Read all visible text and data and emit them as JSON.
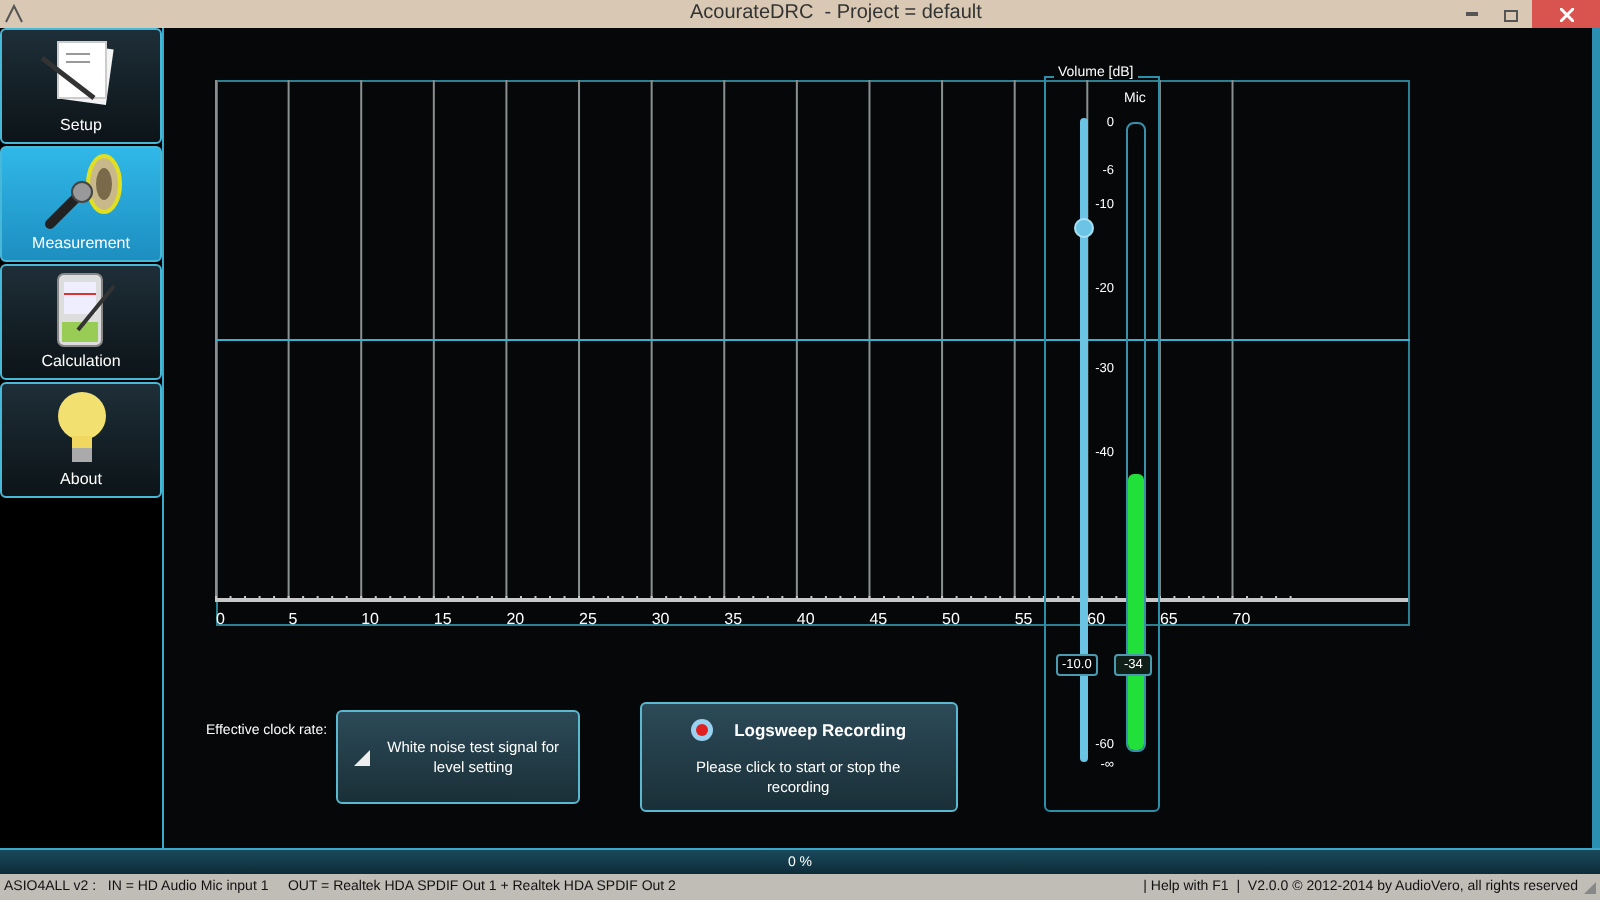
{
  "window": {
    "title": "AcourateDRC  - Project = default"
  },
  "sidebar": {
    "items": [
      {
        "label": "Setup",
        "selected": false,
        "kind": "setup"
      },
      {
        "label": "Measurement",
        "selected": true,
        "kind": "measure"
      },
      {
        "label": "Calculation",
        "selected": false,
        "kind": "calc"
      },
      {
        "label": "About",
        "selected": false,
        "kind": "about"
      }
    ]
  },
  "chart": {
    "x_labels": [
      "0",
      "5",
      "10",
      "15",
      "20",
      "25",
      "30",
      "35",
      "40",
      "45",
      "50",
      "55",
      "60",
      "65",
      "70"
    ]
  },
  "volume": {
    "title": "Volume [dB]",
    "mic_label": "Mic",
    "scale": [
      "0",
      "-6",
      "-10",
      "-20",
      "-30",
      "-40",
      "-60",
      "-∞"
    ],
    "slider": {
      "level": 0.83,
      "reading": "-10.0"
    },
    "meter": {
      "level": 0.44,
      "reading": "-34"
    }
  },
  "clock_label": "Effective clock rate:",
  "white_noise_button": {
    "label": "White noise test signal for level setting"
  },
  "logsweep_button": {
    "title": "Logsweep Recording",
    "subtitle": "Please click to start or stop the recording"
  },
  "progress": {
    "level": 0,
    "label": "0 %"
  },
  "status_bar": {
    "left": "ASIO4ALL v2 :   IN = HD Audio Mic input 1     OUT = Realtek HDA SPDIF Out 1 + Realtek HDA SPDIF Out 2",
    "right": "| Help with F1  |  V2.0.0 © 2012-2014 by AudioVero, all rights reserved"
  }
}
